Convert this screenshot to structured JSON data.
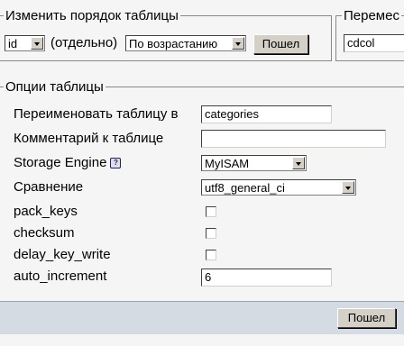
{
  "reorder": {
    "legend": "Изменить порядок таблицы",
    "column_value": "id",
    "separately_label": "(отдельно)",
    "order_value": "По возрастанию",
    "go_label": "Пошел"
  },
  "move": {
    "legend": "Перемес",
    "db_value": "cdcol"
  },
  "options": {
    "legend": "Опции таблицы",
    "rename_label": "Переименовать таблицу в",
    "rename_value": "categories",
    "comment_label": "Комментарий к таблице",
    "comment_value": "",
    "engine_label": "Storage Engine",
    "engine_help": "?",
    "engine_value": "MyISAM",
    "collation_label": "Сравнение",
    "collation_value": "utf8_general_ci",
    "pack_keys_label": "pack_keys",
    "checksum_label": "checksum",
    "delay_key_write_label": "delay_key_write",
    "auto_increment_label": "auto_increment",
    "auto_increment_value": "6",
    "go_label": "Пошел"
  }
}
